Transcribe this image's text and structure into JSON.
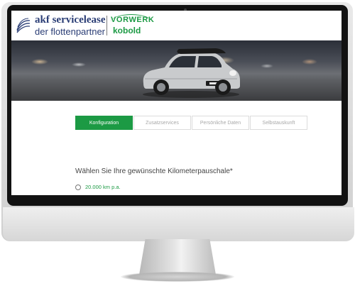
{
  "header": {
    "akf": {
      "title": "akf servicelease",
      "subtitle": "der flottenpartner"
    },
    "vorwerk": {
      "brand": "VORWERK",
      "product": "kobold"
    }
  },
  "steps": [
    {
      "label": "Konfiguration",
      "active": true
    },
    {
      "label": "Zusatzservices",
      "active": false
    },
    {
      "label": "Persönliche Daten",
      "active": false
    },
    {
      "label": "Selbstauskunft",
      "active": false
    }
  ],
  "form": {
    "question": "Wählen Sie Ihre gewünschte Kilometerpauschale*",
    "options": [
      {
        "label": "20.000 km p.a.",
        "selected": false
      }
    ]
  },
  "colors": {
    "accent": "#1c9a44",
    "akf_navy": "#2a3d75"
  }
}
